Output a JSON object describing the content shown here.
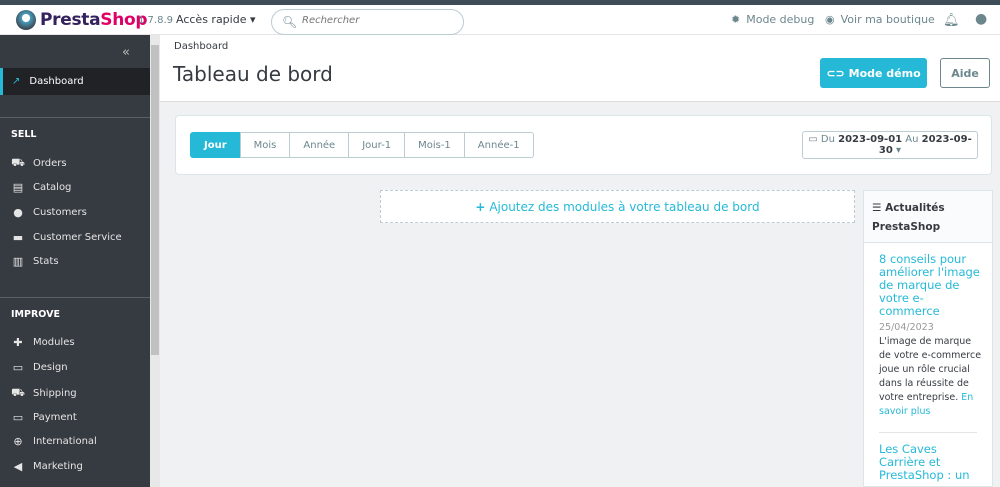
{
  "header": {
    "brand_left": "Presta",
    "brand_right": "Shop",
    "version": "1.7.8.9",
    "quick_access": "Accès rapide",
    "search_placeholder": "Rechercher",
    "debug": "Mode debug",
    "view_shop": "Voir ma boutique"
  },
  "sidebar": {
    "dashboard": "Dashboard",
    "sections": [
      {
        "title": "SELL",
        "items": [
          "Orders",
          "Catalog",
          "Customers",
          "Customer Service",
          "Stats"
        ]
      },
      {
        "title": "IMPROVE",
        "items": [
          "Modules",
          "Design",
          "Shipping",
          "Payment",
          "International",
          "Marketing"
        ]
      }
    ]
  },
  "toolbar": {
    "breadcrumb": "Dashboard",
    "title": "Tableau de bord",
    "demo": "Mode démo",
    "help": "Aide"
  },
  "periods": [
    "Jour",
    "Mois",
    "Année",
    "Jour-1",
    "Mois-1",
    "Année-1"
  ],
  "date_range": {
    "du": "Du",
    "from": "2023-09-01",
    "au": "Au",
    "to": "2023-09-30"
  },
  "add_modules": "Ajoutez des modules à votre tableau de bord",
  "news": {
    "title": "Actualités PrestaShop",
    "articles": [
      {
        "title": "8 conseils pour améliorer l'image de marque de votre e-commerce",
        "date": "25/04/2023",
        "body": "L'image de marque de votre e-commerce joue un rôle crucial dans la réussite de votre entreprise.",
        "more": "En savoir plus"
      },
      {
        "title": "Les Caves Carrière et PrestaShop : un"
      }
    ]
  }
}
